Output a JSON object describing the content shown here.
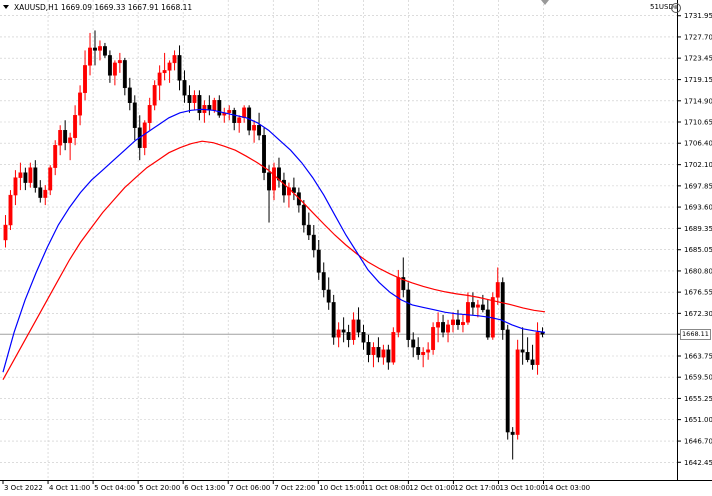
{
  "header": {
    "symbol_info": "XAUUSD,H1  1669.09 1669.33 1667.91 1668.11",
    "one_click_label": "51USD",
    "close_glyph": "⊗"
  },
  "current_price": "1668.11",
  "colors": {
    "bull": "#ff0000",
    "bear": "#000000",
    "ma_fast": "#0000ff",
    "ma_slow": "#ff0000",
    "grid": "#c8c8c8",
    "bid_line": "#a0a0a0"
  },
  "price_axis_labels": [
    "1731.95",
    "1727.70",
    "1723.45",
    "1719.15",
    "1714.90",
    "1710.65",
    "1706.40",
    "1702.10",
    "1697.85",
    "1693.60",
    "1689.35",
    "1685.05",
    "1680.80",
    "1676.55",
    "1672.30",
    "1668.11",
    "1663.75",
    "1659.50",
    "1655.25",
    "1651.00",
    "1646.70",
    "1642.45"
  ],
  "time_axis_labels": [
    "3 Oct 2022",
    "4 Oct 11:00",
    "5 Oct 04:00",
    "5 Oct 20:00",
    "6 Oct 13:00",
    "7 Oct 06:00",
    "7 Oct 22:00",
    "10 Oct 15:00",
    "11 Oct 08:00",
    "12 Oct 01:00",
    "12 Oct 17:00",
    "13 Oct 10:00",
    "14 Oct 03:00"
  ],
  "chart_data": {
    "type": "candlestick",
    "symbol": "XAUUSD",
    "timeframe": "H1",
    "ylim": [
      1640.5,
      1733.5
    ],
    "candles": [
      [
        1687.0,
        1692.0,
        1685.5,
        1690.0
      ],
      [
        1690.0,
        1697.0,
        1689.0,
        1696.0
      ],
      [
        1696.0,
        1701.0,
        1694.0,
        1699.5
      ],
      [
        1699.5,
        1702.5,
        1697.0,
        1700.5
      ],
      [
        1700.5,
        1701.5,
        1697.0,
        1698.5
      ],
      [
        1698.5,
        1702.5,
        1697.5,
        1701.5
      ],
      [
        1701.5,
        1703.0,
        1696.5,
        1697.5
      ],
      [
        1697.5,
        1699.0,
        1694.5,
        1695.5
      ],
      [
        1695.5,
        1698.0,
        1694.0,
        1697.0
      ],
      [
        1697.0,
        1702.0,
        1696.0,
        1701.5
      ],
      [
        1701.5,
        1707.0,
        1700.0,
        1706.0
      ],
      [
        1706.0,
        1710.0,
        1704.0,
        1709.0
      ],
      [
        1709.0,
        1711.0,
        1705.0,
        1706.5
      ],
      [
        1706.5,
        1708.5,
        1703.0,
        1707.5
      ],
      [
        1707.5,
        1714.0,
        1706.0,
        1712.0
      ],
      [
        1712.0,
        1718.0,
        1710.0,
        1716.5
      ],
      [
        1716.5,
        1725.0,
        1715.0,
        1722.0
      ],
      [
        1722.0,
        1728.5,
        1720.0,
        1725.5
      ],
      [
        1725.5,
        1729.0,
        1722.0,
        1725.0
      ],
      [
        1725.0,
        1727.0,
        1723.0,
        1725.8
      ],
      [
        1725.8,
        1726.5,
        1723.5,
        1724.0
      ],
      [
        1724.0,
        1725.0,
        1718.5,
        1720.0
      ],
      [
        1720.0,
        1723.0,
        1718.0,
        1722.5
      ],
      [
        1722.5,
        1724.5,
        1720.5,
        1723.0
      ],
      [
        1723.0,
        1723.5,
        1716.0,
        1717.5
      ],
      [
        1717.5,
        1719.5,
        1713.0,
        1714.5
      ],
      [
        1714.5,
        1716.0,
        1707.0,
        1709.5
      ],
      [
        1709.5,
        1712.0,
        1703.0,
        1705.5
      ],
      [
        1705.5,
        1711.0,
        1704.0,
        1710.5
      ],
      [
        1710.5,
        1715.5,
        1709.0,
        1714.0
      ],
      [
        1714.0,
        1719.0,
        1713.0,
        1718.0
      ],
      [
        1718.0,
        1722.0,
        1715.0,
        1720.5
      ],
      [
        1720.5,
        1724.5,
        1719.0,
        1721.0
      ],
      [
        1721.0,
        1723.0,
        1718.5,
        1722.5
      ],
      [
        1722.5,
        1725.0,
        1721.0,
        1724.0
      ],
      [
        1724.0,
        1726.0,
        1717.0,
        1719.0
      ],
      [
        1719.0,
        1721.0,
        1714.5,
        1716.0
      ],
      [
        1716.0,
        1718.0,
        1712.5,
        1714.5
      ],
      [
        1714.5,
        1717.0,
        1713.0,
        1716.0
      ],
      [
        1716.0,
        1717.0,
        1711.0,
        1712.5
      ],
      [
        1712.5,
        1715.0,
        1710.5,
        1714.0
      ],
      [
        1714.0,
        1716.0,
        1712.0,
        1713.0
      ],
      [
        1713.0,
        1715.5,
        1712.5,
        1715.0
      ],
      [
        1715.0,
        1716.0,
        1711.5,
        1712.0
      ],
      [
        1712.0,
        1713.5,
        1710.5,
        1712.5
      ],
      [
        1712.5,
        1714.0,
        1711.0,
        1713.0
      ],
      [
        1713.0,
        1713.5,
        1709.0,
        1710.5
      ],
      [
        1710.5,
        1712.0,
        1708.5,
        1711.5
      ],
      [
        1711.5,
        1714.0,
        1710.5,
        1713.5
      ],
      [
        1713.5,
        1714.0,
        1708.0,
        1709.0
      ],
      [
        1709.0,
        1711.0,
        1706.5,
        1710.0
      ],
      [
        1710.0,
        1712.5,
        1707.0,
        1708.0
      ],
      [
        1708.0,
        1709.5,
        1699.0,
        1700.5
      ],
      [
        1700.5,
        1702.0,
        1690.5,
        1697.0
      ],
      [
        1697.0,
        1702.5,
        1695.0,
        1701.5
      ],
      [
        1701.5,
        1703.5,
        1697.5,
        1699.0
      ],
      [
        1699.0,
        1700.5,
        1694.5,
        1696.0
      ],
      [
        1696.0,
        1698.5,
        1693.5,
        1697.5
      ],
      [
        1697.5,
        1699.5,
        1695.0,
        1696.5
      ],
      [
        1696.5,
        1697.5,
        1692.5,
        1694.0
      ],
      [
        1694.0,
        1695.0,
        1688.5,
        1690.0
      ],
      [
        1690.0,
        1692.5,
        1687.0,
        1688.0
      ],
      [
        1688.0,
        1690.0,
        1683.5,
        1685.0
      ],
      [
        1685.0,
        1687.0,
        1679.0,
        1680.5
      ],
      [
        1680.5,
        1682.5,
        1675.5,
        1677.0
      ],
      [
        1677.0,
        1679.5,
        1673.0,
        1674.5
      ],
      [
        1674.5,
        1676.0,
        1666.0,
        1667.5
      ],
      [
        1667.5,
        1670.5,
        1665.5,
        1669.0
      ],
      [
        1669.0,
        1671.5,
        1666.5,
        1668.5
      ],
      [
        1668.5,
        1670.0,
        1665.5,
        1667.0
      ],
      [
        1667.0,
        1672.5,
        1666.0,
        1671.0
      ],
      [
        1671.0,
        1673.5,
        1667.5,
        1668.5
      ],
      [
        1668.5,
        1670.0,
        1665.0,
        1666.5
      ],
      [
        1666.5,
        1668.0,
        1662.5,
        1664.0
      ],
      [
        1664.0,
        1666.5,
        1661.5,
        1665.5
      ],
      [
        1665.5,
        1667.5,
        1662.5,
        1663.5
      ],
      [
        1663.5,
        1666.0,
        1662.0,
        1665.0
      ],
      [
        1665.0,
        1666.0,
        1661.0,
        1662.5
      ],
      [
        1662.5,
        1669.5,
        1662.0,
        1668.5
      ],
      [
        1668.5,
        1681.0,
        1667.5,
        1679.5
      ],
      [
        1679.5,
        1683.5,
        1675.5,
        1677.0
      ],
      [
        1677.0,
        1678.5,
        1665.5,
        1667.0
      ],
      [
        1667.0,
        1668.5,
        1663.5,
        1665.5
      ],
      [
        1665.5,
        1667.5,
        1663.0,
        1664.0
      ],
      [
        1664.0,
        1665.5,
        1661.5,
        1664.5
      ],
      [
        1664.5,
        1666.5,
        1663.0,
        1665.0
      ],
      [
        1665.0,
        1670.5,
        1664.0,
        1669.5
      ],
      [
        1669.5,
        1672.5,
        1666.5,
        1670.5
      ],
      [
        1670.5,
        1672.0,
        1667.5,
        1668.5
      ],
      [
        1668.5,
        1671.0,
        1666.5,
        1670.0
      ],
      [
        1670.0,
        1672.5,
        1668.5,
        1671.0
      ],
      [
        1671.0,
        1673.0,
        1669.0,
        1670.0
      ],
      [
        1670.0,
        1672.0,
        1668.5,
        1670.5
      ],
      [
        1670.5,
        1676.5,
        1670.0,
        1674.5
      ],
      [
        1674.5,
        1676.5,
        1672.0,
        1673.5
      ],
      [
        1673.5,
        1675.0,
        1671.5,
        1674.0
      ],
      [
        1674.0,
        1676.0,
        1672.5,
        1673.0
      ],
      [
        1673.0,
        1675.0,
        1667.0,
        1667.5
      ],
      [
        1667.5,
        1676.5,
        1667.0,
        1675.5
      ],
      [
        1675.5,
        1681.5,
        1674.0,
        1678.5
      ],
      [
        1678.5,
        1679.5,
        1667.0,
        1669.0
      ],
      [
        1669.0,
        1670.0,
        1647.0,
        1648.5
      ],
      [
        1648.5,
        1649.5,
        1643.0,
        1648.0
      ],
      [
        1648.0,
        1667.0,
        1647.0,
        1665.0
      ],
      [
        1665.0,
        1669.5,
        1662.0,
        1664.5
      ],
      [
        1664.5,
        1667.5,
        1662.5,
        1663.0
      ],
      [
        1663.0,
        1666.0,
        1661.0,
        1662.0
      ],
      [
        1662.0,
        1670.5,
        1660.0,
        1668.5
      ],
      [
        1668.5,
        1669.5,
        1667.5,
        1668.1
      ]
    ],
    "ma_fast": [
      1660.5,
      1668.5,
      1675.0,
      1680.5,
      1685.5,
      1690.0,
      1693.5,
      1696.5,
      1699.0,
      1701.0,
      1703.0,
      1705.0,
      1707.0,
      1708.5,
      1710.0,
      1711.5,
      1712.5,
      1713.0,
      1713.2,
      1713.0,
      1712.5,
      1712.0,
      1711.5,
      1710.5,
      1709.0,
      1707.0,
      1705.0,
      1702.5,
      1699.5,
      1696.0,
      1692.0,
      1688.0,
      1684.5,
      1681.0,
      1678.5,
      1676.5,
      1675.0,
      1674.0,
      1673.5,
      1673.0,
      1672.5,
      1672.2,
      1672.0,
      1671.8,
      1671.5,
      1671.0,
      1670.0,
      1669.2,
      1668.8,
      1668.5
    ],
    "ma_slow": [
      1659.0,
      1663.0,
      1667.0,
      1671.0,
      1675.0,
      1679.0,
      1683.0,
      1686.5,
      1689.5,
      1692.5,
      1695.0,
      1697.5,
      1699.5,
      1701.5,
      1703.0,
      1704.5,
      1705.5,
      1706.3,
      1706.8,
      1706.5,
      1705.8,
      1705.0,
      1703.8,
      1702.5,
      1701.0,
      1699.0,
      1697.0,
      1694.8,
      1692.5,
      1690.2,
      1688.0,
      1686.0,
      1684.2,
      1682.6,
      1681.3,
      1680.2,
      1679.2,
      1678.4,
      1677.7,
      1677.1,
      1676.6,
      1676.2,
      1675.9,
      1675.5,
      1675.0,
      1674.5,
      1674.0,
      1673.4,
      1672.9,
      1672.6
    ]
  }
}
